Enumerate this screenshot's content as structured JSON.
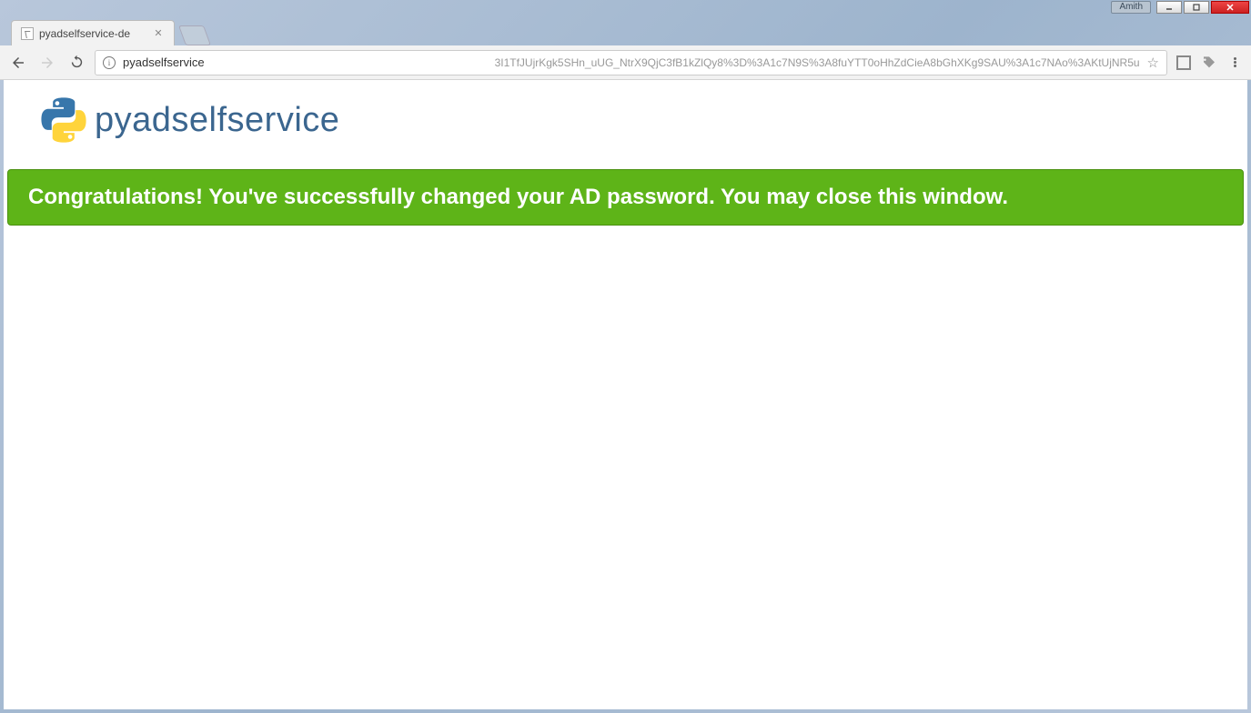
{
  "window": {
    "user_label": "Amith",
    "minimize": "—",
    "maximize": "▢",
    "close": "✕"
  },
  "browser": {
    "tab_title": "pyadselfservice-de",
    "url_host": "pyadselfservice",
    "url_rest": "3I1TfJUjrKgk5SHn_uUG_NtrX9QjC3fB1kZlQy8%3D%3A1c7N9S%3A8fuYTT0oHhZdCieA8bGhXKg9SAU%3A1c7NAo%3AKtUjNR5u"
  },
  "page": {
    "app_name": "pyadselfservice",
    "banner_text": "Congratulations! You've successfully changed your AD password. You may close this window."
  }
}
